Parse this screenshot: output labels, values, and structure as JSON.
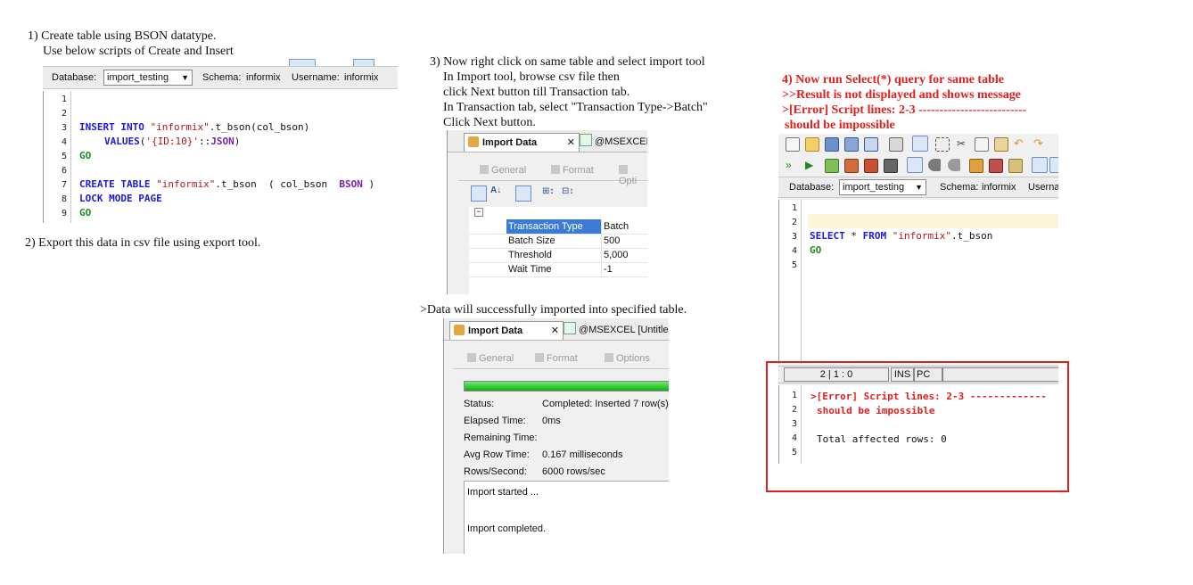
{
  "step1": {
    "line1": "1) Create table using BSON datatype.",
    "line2": "Use below scripts of Create and Insert"
  },
  "step2": {
    "text": "2) Export this data in csv file using export tool."
  },
  "step3": {
    "lines": [
      "3) Now right click on same table and select import tool",
      "In Import tool, browse csv file then",
      "click Next button till Transaction tab.",
      "In Transaction tab, select \"Transaction Type->Batch\"",
      "Click Next button."
    ],
    "success_note": ">Data will successfully imported into specified table."
  },
  "step4": {
    "lines": [
      "4) Now run Select(*) query for same table",
      ">>Result is not displayed and shows message",
      ">[Error] Script lines: 2-3 --------------------------",
      "should be impossible"
    ]
  },
  "editor1": {
    "db_label": "Database:",
    "db_value": "import_testing",
    "schema_label": "Schema:",
    "schema_value": "informix",
    "user_label": "Username:",
    "user_value": "informix",
    "line_numbers": [
      "1",
      "2",
      "3",
      "4",
      "5",
      "6",
      "7",
      "8",
      "9"
    ],
    "code": {
      "l3_kw": "INSERT INTO",
      "l3_str": "\"informix\"",
      "l3_rest": ".t_bson(col_bson)",
      "l4_kw": "VALUES",
      "l4_open": "(",
      "l4_str": "'{ID:10}'",
      "l4_cast": "::",
      "l4_json": "JSON",
      "l4_close": ")",
      "l5_go": "GO",
      "l7_kw": "CREATE TABLE",
      "l7_str": "\"informix\"",
      "l7_rest": ".t_bson  ( col_bson  ",
      "l7_bson": "BSON",
      "l7_end": " )",
      "l8_kw": "LOCK MODE PAGE",
      "l9_go": "GO"
    }
  },
  "import1": {
    "tab_active": "Import Data",
    "tab_other": "@MSEXCEL |",
    "subtabs": [
      "General",
      "Format",
      "Opti"
    ],
    "props": [
      {
        "k": "Transaction Type",
        "v": "Batch"
      },
      {
        "k": "Batch Size",
        "v": "500"
      },
      {
        "k": "Threshold",
        "v": "5,000"
      },
      {
        "k": "Wait Time",
        "v": "-1"
      }
    ]
  },
  "import2": {
    "tab_active": "Import Data",
    "tab_other": "@MSEXCEL [Untitled]",
    "subtabs": [
      "General",
      "Format",
      "Options"
    ],
    "progress": 1.0,
    "stats": [
      {
        "k": "Status:",
        "v": "Completed: Inserted 7 row(s)"
      },
      {
        "k": "Elapsed Time:",
        "v": "0ms"
      },
      {
        "k": "Remaining Time:",
        "v": ""
      },
      {
        "k": "Avg Row Time:",
        "v": "0.167 milliseconds"
      },
      {
        "k": "Rows/Second:",
        "v": "6000 rows/sec"
      }
    ],
    "log_line1": "Import started ...",
    "log_line2": "Import completed."
  },
  "editor2": {
    "db_label": "Database:",
    "db_value": "import_testing",
    "schema_label": "Schema:",
    "schema_value": "informix",
    "user_label": "Userna",
    "line_numbers": [
      "1",
      "2",
      "3",
      "4",
      "5"
    ],
    "code": {
      "kw1": "SELECT",
      "star": " * ",
      "kw2": "FROM",
      "str": "\"informix\"",
      "rest": ".t_bson",
      "go": "GO"
    },
    "status": {
      "pos": "2 | 1 : 0",
      "ins": "INS",
      "pc": "PC"
    },
    "output_line_numbers": [
      "1",
      "2",
      "3",
      "4",
      "5"
    ],
    "output": {
      "l1": ">[Error] Script lines: 2-3 -------------",
      "l2": "should be impossible",
      "l4": "Total affected rows: 0"
    }
  },
  "colors": {
    "error_red": "#e0201b",
    "keyword_blue": "#1b1bd6",
    "string_red": "#b01818",
    "go_green": "#1f8a1f",
    "selection_blue": "#3a7bd5",
    "progress_green": "#2ecc2e"
  }
}
